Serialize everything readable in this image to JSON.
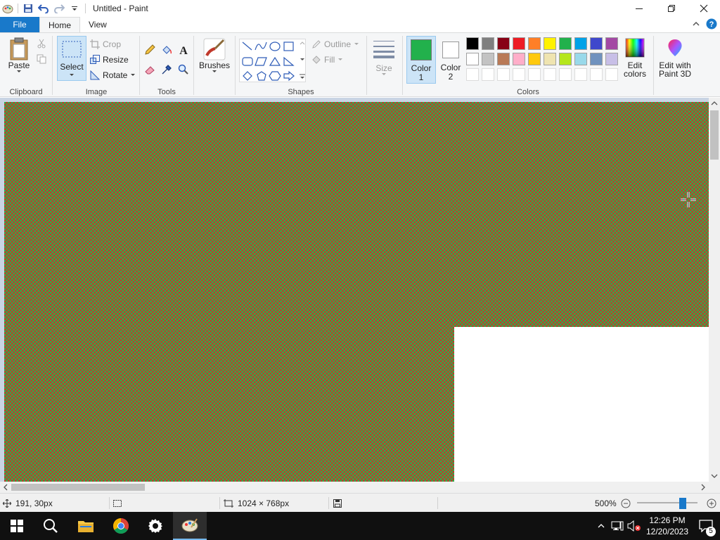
{
  "window": {
    "title": "Untitled - Paint"
  },
  "tabs": {
    "file": "File",
    "home": "Home",
    "view": "View"
  },
  "clipboard": {
    "paste": "Paste",
    "group": "Clipboard"
  },
  "image": {
    "select": "Select",
    "crop": "Crop",
    "resize": "Resize",
    "rotate": "Rotate",
    "group": "Image"
  },
  "tools": {
    "group": "Tools"
  },
  "brushes": {
    "label": "Brushes"
  },
  "shapes": {
    "outline": "Outline",
    "fill": "Fill",
    "group": "Shapes"
  },
  "size": {
    "label": "Size"
  },
  "colors": {
    "color1_line1": "Color",
    "color1_line2": "1",
    "color2_line1": "Color",
    "color2_line2": "2",
    "edit_line1": "Edit",
    "edit_line2": "colors",
    "group": "Colors",
    "color1_value": "#22b14c",
    "color2_value": "#ffffff",
    "palette_row1": [
      "#000000",
      "#7f7f7f",
      "#880015",
      "#ed1c24",
      "#ff7f27",
      "#fff200",
      "#22b14c",
      "#00a2e8",
      "#3f48cc",
      "#a349a4"
    ],
    "palette_row2": [
      "#ffffff",
      "#c3c3c3",
      "#b97a57",
      "#ffaec9",
      "#ffc90e",
      "#efe4b0",
      "#b5e61d",
      "#99d9ea",
      "#7092be",
      "#c8bfe7"
    ]
  },
  "paint3d": {
    "line1": "Edit with",
    "line2": "Paint 3D"
  },
  "status": {
    "cursor_pos": "191, 30px",
    "canvas_size": "1024 × 768px",
    "zoom": "500%"
  },
  "taskbar": {
    "time": "12:26 PM",
    "date": "12/20/2023",
    "notifications": "5"
  }
}
